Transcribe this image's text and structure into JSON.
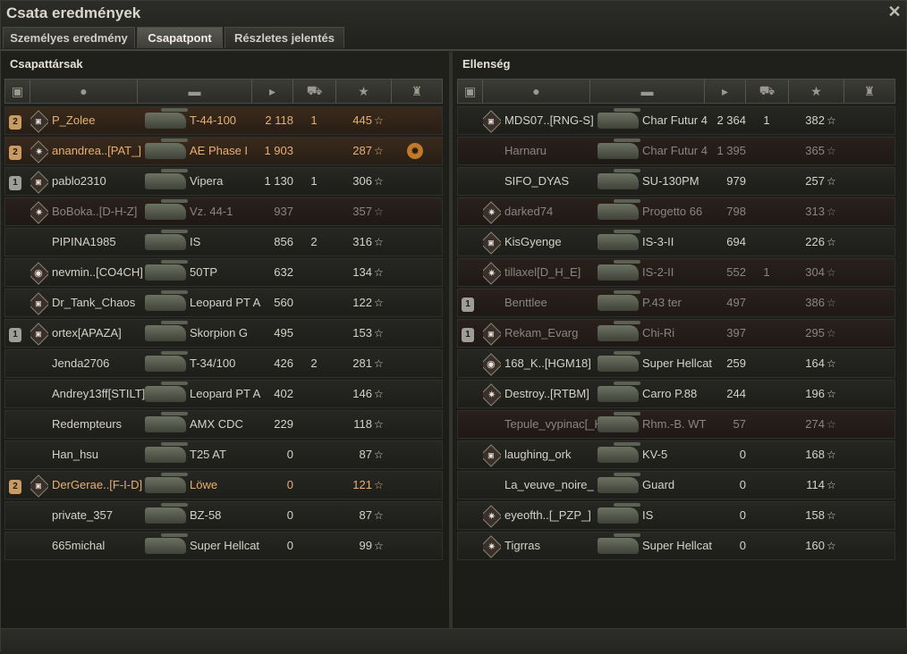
{
  "window": {
    "title": "Csata eredmények",
    "close_icon": "close-icon"
  },
  "tabs": [
    {
      "label": "Személyes eredmény",
      "active": false
    },
    {
      "label": "Csapatpont",
      "active": true
    },
    {
      "label": "Részletes jelentés",
      "active": false
    }
  ],
  "team_left": {
    "title": "Csapattársak",
    "columns": [
      "platoon-icon",
      "player-icon",
      "tank-icon",
      "damage-icon",
      "kills-icon",
      "xp-star-icon",
      "medal-icon"
    ],
    "rows": [
      {
        "platoon": "2",
        "platoon_color": "gold",
        "badge": "◈",
        "name": "P_Zolee",
        "tank": "T-44-100",
        "dmg": "2 118",
        "kills": "1",
        "xp": "445",
        "medal": "",
        "style": "squad me"
      },
      {
        "platoon": "2",
        "platoon_color": "gold",
        "badge": "✷",
        "name": "anandrea..[PAT_]",
        "tank": "AE Phase I",
        "dmg": "1 903",
        "kills": "",
        "xp": "287",
        "medal": "✹",
        "style": "squad me"
      },
      {
        "platoon": "1",
        "platoon_color": "grey",
        "badge": "◈",
        "name": "pablo2310",
        "tank": "Vipera",
        "dmg": "1 130",
        "kills": "1",
        "xp": "306",
        "medal": "",
        "style": ""
      },
      {
        "platoon": "",
        "platoon_color": "",
        "badge": "✷",
        "name": "BoBoka..[D-H-Z]",
        "tank": "Vz. 44-1",
        "dmg": "937",
        "kills": "",
        "xp": "357",
        "medal": "",
        "style": "dead"
      },
      {
        "platoon": "",
        "platoon_color": "",
        "badge": "",
        "name": "PIPINA1985",
        "tank": "IS",
        "dmg": "856",
        "kills": "2",
        "xp": "316",
        "medal": "",
        "style": ""
      },
      {
        "platoon": "",
        "platoon_color": "",
        "badge": "◉",
        "name": "nevmin..[CO4CH]",
        "tank": "50TP",
        "dmg": "632",
        "kills": "",
        "xp": "134",
        "medal": "",
        "style": ""
      },
      {
        "platoon": "",
        "platoon_color": "",
        "badge": "◈",
        "name": "Dr_Tank_Chaos",
        "tank": "Leopard PT A",
        "dmg": "560",
        "kills": "",
        "xp": "122",
        "medal": "",
        "style": ""
      },
      {
        "platoon": "1",
        "platoon_color": "grey",
        "badge": "◈",
        "name": "ortex[APAZA]",
        "tank": "Skorpion G",
        "dmg": "495",
        "kills": "",
        "xp": "153",
        "medal": "",
        "style": ""
      },
      {
        "platoon": "",
        "platoon_color": "",
        "badge": "",
        "name": "Jenda2706",
        "tank": "T-34/100",
        "dmg": "426",
        "kills": "2",
        "xp": "281",
        "medal": "",
        "style": ""
      },
      {
        "platoon": "",
        "platoon_color": "",
        "badge": "",
        "name": "Andrey13ff[STILT]",
        "tank": "Leopard PT A",
        "dmg": "402",
        "kills": "",
        "xp": "146",
        "medal": "",
        "style": ""
      },
      {
        "platoon": "",
        "platoon_color": "",
        "badge": "",
        "name": "Redempteurs",
        "tank": "AMX CDC",
        "dmg": "229",
        "kills": "",
        "xp": "118",
        "medal": "",
        "style": ""
      },
      {
        "platoon": "",
        "platoon_color": "",
        "badge": "",
        "name": "Han_hsu",
        "tank": "T25 AT",
        "dmg": "0",
        "kills": "",
        "xp": "87",
        "medal": "",
        "style": ""
      },
      {
        "platoon": "2",
        "platoon_color": "gold",
        "badge": "◈",
        "name": "DerGerae..[F-I-D]",
        "tank": "Löwe",
        "dmg": "0",
        "kills": "",
        "xp": "121",
        "medal": "",
        "style": "me"
      },
      {
        "platoon": "",
        "platoon_color": "",
        "badge": "",
        "name": "private_357",
        "tank": "BZ-58",
        "dmg": "0",
        "kills": "",
        "xp": "87",
        "medal": "",
        "style": ""
      },
      {
        "platoon": "",
        "platoon_color": "",
        "badge": "",
        "name": "665michal",
        "tank": "Super Hellcat",
        "dmg": "0",
        "kills": "",
        "xp": "99",
        "medal": "",
        "style": ""
      }
    ]
  },
  "team_right": {
    "title": "Ellenség",
    "columns": [
      "platoon-icon",
      "player-icon",
      "tank-icon",
      "damage-icon",
      "kills-icon",
      "xp-star-icon",
      "medal-icon"
    ],
    "rows": [
      {
        "platoon": "",
        "platoon_color": "",
        "badge": "◈",
        "name": "MDS07..[RNG-S]",
        "tank": "Char Futur 4",
        "dmg": "2 364",
        "kills": "1",
        "xp": "382",
        "medal": "",
        "style": ""
      },
      {
        "platoon": "",
        "platoon_color": "",
        "badge": "",
        "name": "Harnaru",
        "tank": "Char Futur 4",
        "dmg": "1 395",
        "kills": "",
        "xp": "365",
        "medal": "",
        "style": "dead"
      },
      {
        "platoon": "",
        "platoon_color": "",
        "badge": "",
        "name": "SIFO_DYAS",
        "tank": "SU-130PM",
        "dmg": "979",
        "kills": "",
        "xp": "257",
        "medal": "",
        "style": ""
      },
      {
        "platoon": "",
        "platoon_color": "",
        "badge": "✷",
        "name": "darked74",
        "tank": "Progetto 66",
        "dmg": "798",
        "kills": "",
        "xp": "313",
        "medal": "",
        "style": "dead"
      },
      {
        "platoon": "",
        "platoon_color": "",
        "badge": "◈",
        "name": "KisGyenge",
        "tank": "IS-3-II",
        "dmg": "694",
        "kills": "",
        "xp": "226",
        "medal": "",
        "style": ""
      },
      {
        "platoon": "",
        "platoon_color": "",
        "badge": "✷",
        "name": "tillaxel[D_H_E]",
        "tank": "IS-2-II",
        "dmg": "552",
        "kills": "1",
        "xp": "304",
        "medal": "",
        "style": "dead"
      },
      {
        "platoon": "1",
        "platoon_color": "grey",
        "badge": "",
        "name": "Benttlee",
        "tank": "P.43 ter",
        "dmg": "497",
        "kills": "",
        "xp": "386",
        "medal": "",
        "style": "dead"
      },
      {
        "platoon": "1",
        "platoon_color": "grey",
        "badge": "◈",
        "name": "Rekam_Evarg",
        "tank": "Chi-Ri",
        "dmg": "397",
        "kills": "",
        "xp": "295",
        "medal": "",
        "style": "dead"
      },
      {
        "platoon": "",
        "platoon_color": "",
        "badge": "◉",
        "name": "168_K..[HGM18]",
        "tank": "Super Hellcat",
        "dmg": "259",
        "kills": "",
        "xp": "164",
        "medal": "",
        "style": ""
      },
      {
        "platoon": "",
        "platoon_color": "",
        "badge": "✷",
        "name": "Destroy..[RTBM]",
        "tank": "Carro P.88",
        "dmg": "244",
        "kills": "",
        "xp": "196",
        "medal": "",
        "style": ""
      },
      {
        "platoon": "",
        "platoon_color": "",
        "badge": "",
        "name": "Tepule_vypinac[_HC]",
        "tank": "Rhm.-B. WT",
        "dmg": "57",
        "kills": "",
        "xp": "274",
        "medal": "",
        "style": "dead"
      },
      {
        "platoon": "",
        "platoon_color": "",
        "badge": "◈",
        "name": "laughing_ork",
        "tank": "KV-5",
        "dmg": "0",
        "kills": "",
        "xp": "168",
        "medal": "",
        "style": ""
      },
      {
        "platoon": "",
        "platoon_color": "",
        "badge": "",
        "name": "La_veuve_noire_",
        "tank": "Guard",
        "dmg": "0",
        "kills": "",
        "xp": "114",
        "medal": "",
        "style": ""
      },
      {
        "platoon": "",
        "platoon_color": "",
        "badge": "✷",
        "name": "eyeofth..[_PZP_]",
        "tank": "IS",
        "dmg": "0",
        "kills": "",
        "xp": "158",
        "medal": "",
        "style": ""
      },
      {
        "platoon": "",
        "platoon_color": "",
        "badge": "✷",
        "name": "Tigrras",
        "tank": "Super Hellcat",
        "dmg": "0",
        "kills": "",
        "xp": "160",
        "medal": "",
        "style": ""
      }
    ]
  }
}
